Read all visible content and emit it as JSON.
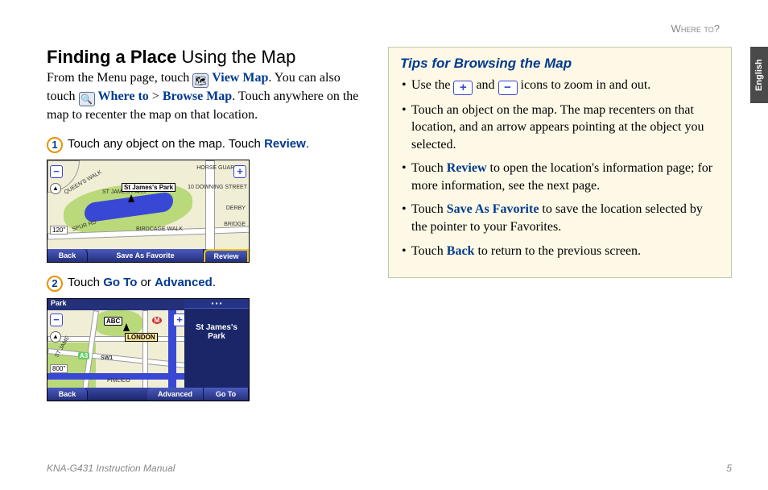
{
  "header": {
    "breadcrumb": "Where to?"
  },
  "sideTab": "English",
  "main": {
    "title_a": "Finding a Place",
    "title_b": "Using the Map",
    "intro_1": "From the Menu page, touch ",
    "viewMap": "View Map",
    "intro_2": ". You can also touch ",
    "whereTo": "Where to",
    "gt": " > ",
    "browseMap": "Browse Map",
    "intro_3": ". Touch anywhere on the map to recenter the map on that location.",
    "step1_a": "Touch any object on the map. Touch ",
    "step1_b": "Review",
    "step1_c": ".",
    "step2_a": "Touch ",
    "step2_b": "Go To",
    "step2_c": " or ",
    "step2_d": "Advanced",
    "step2_e": "."
  },
  "map1": {
    "label_place": "St James's Park",
    "lbl_horse": "HORSE GUARDS",
    "lbl_downing": "10 DOWNING STREET",
    "lbl_derby": "DERBY",
    "lbl_bridge": "BRIDGE",
    "lbl_birdcage": "BIRDCAGE WALK",
    "lbl_queens": "QUEEN'S WALK",
    "lbl_spur": "SPUR RD",
    "lbl_stjames": "ST JAMES PARK",
    "scale": "120\"",
    "btn_back": "Back",
    "btn_save": "Save As Favorite",
    "btn_review": "Review"
  },
  "map2": {
    "top_label": "Park",
    "scale": "800\"",
    "place_name": "St James's Park",
    "lbl_london": "LONDON",
    "lbl_sw1": "SW1",
    "lbl_pimlico": "PIMLICO",
    "lbl_stj": "ST JAME",
    "lbl_a3": "A3",
    "lbl_abc": "ABC",
    "lbl_m": "M",
    "btn_back": "Back",
    "btn_adv": "Advanced",
    "btn_goto": "Go To"
  },
  "tips": {
    "title": "Tips for Browsing the Map",
    "t1a": "Use the ",
    "t1b": " and ",
    "t1c": " icons to zoom in and out.",
    "t2": "Touch an object on the map. The map recenters on that location, and an arrow appears pointing at the object you selected.",
    "t3a": "Touch ",
    "t3b": "Review",
    "t3c": " to open the location's information page; for more information, see the next page.",
    "t4a": "Touch ",
    "t4b": "Save As Favorite",
    "t4c": " to save the location selected by the pointer to your Favorites.",
    "t5a": "Touch ",
    "t5b": "Back",
    "t5c": " to return to the previous screen."
  },
  "footer": {
    "left": "KNA-G431 Instruction Manual",
    "right": "5"
  }
}
